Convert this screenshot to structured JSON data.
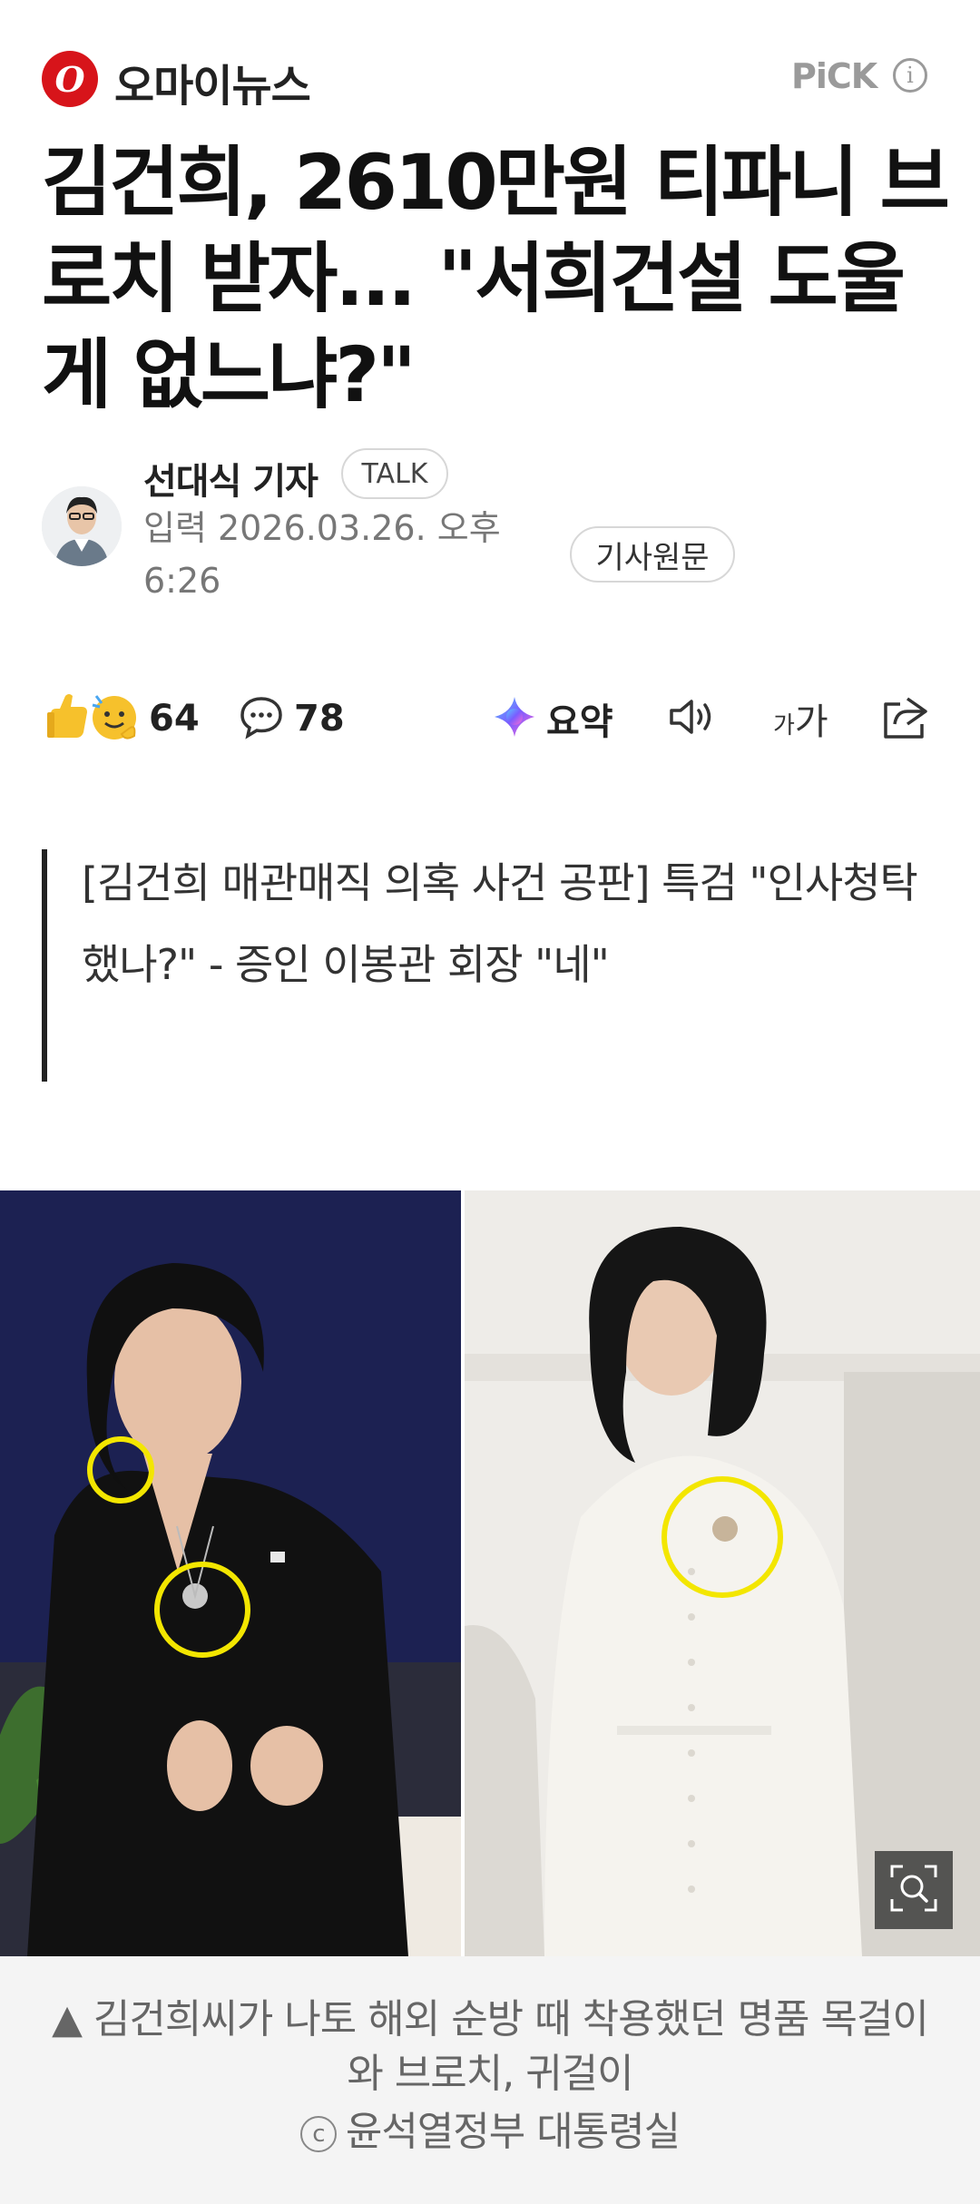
{
  "header": {
    "logo_letter": "O",
    "press_name": "오마이뉴스",
    "pick_label": "PiCK",
    "info_glyph": "i"
  },
  "article": {
    "headline": "김건희, 2610만원 티파니 브로치 받자... \"서희건설 도울 게 없느냐?\"",
    "reporter_name": "선대식 기자",
    "talk_label": "TALK",
    "date_text": "입력 2026.03.26. 오후 6:26",
    "source_label": "기사원문"
  },
  "actions": {
    "reaction_count": "64",
    "comment_count": "78",
    "summary_label": "요약",
    "font_label_small": "가",
    "font_label_large": "가"
  },
  "quote": {
    "text": "[김건희 매관매직 의혹 사건 공판] 특검 \"인사청탁 했나?\" - 증인 이봉관 회장 \"네\""
  },
  "photo": {
    "caption": "▲ 김건희씨가 나토 해외 순방 때 착용했던 명품 목걸이와 브로치, 귀걸이",
    "copyright_symbol": "c",
    "copyright_text": "윤석열정부 대통령실"
  },
  "colors": {
    "brand_red": "#d7141a",
    "highlight_yellow": "#f3e600",
    "muted_gray": "#9a9a9a"
  }
}
